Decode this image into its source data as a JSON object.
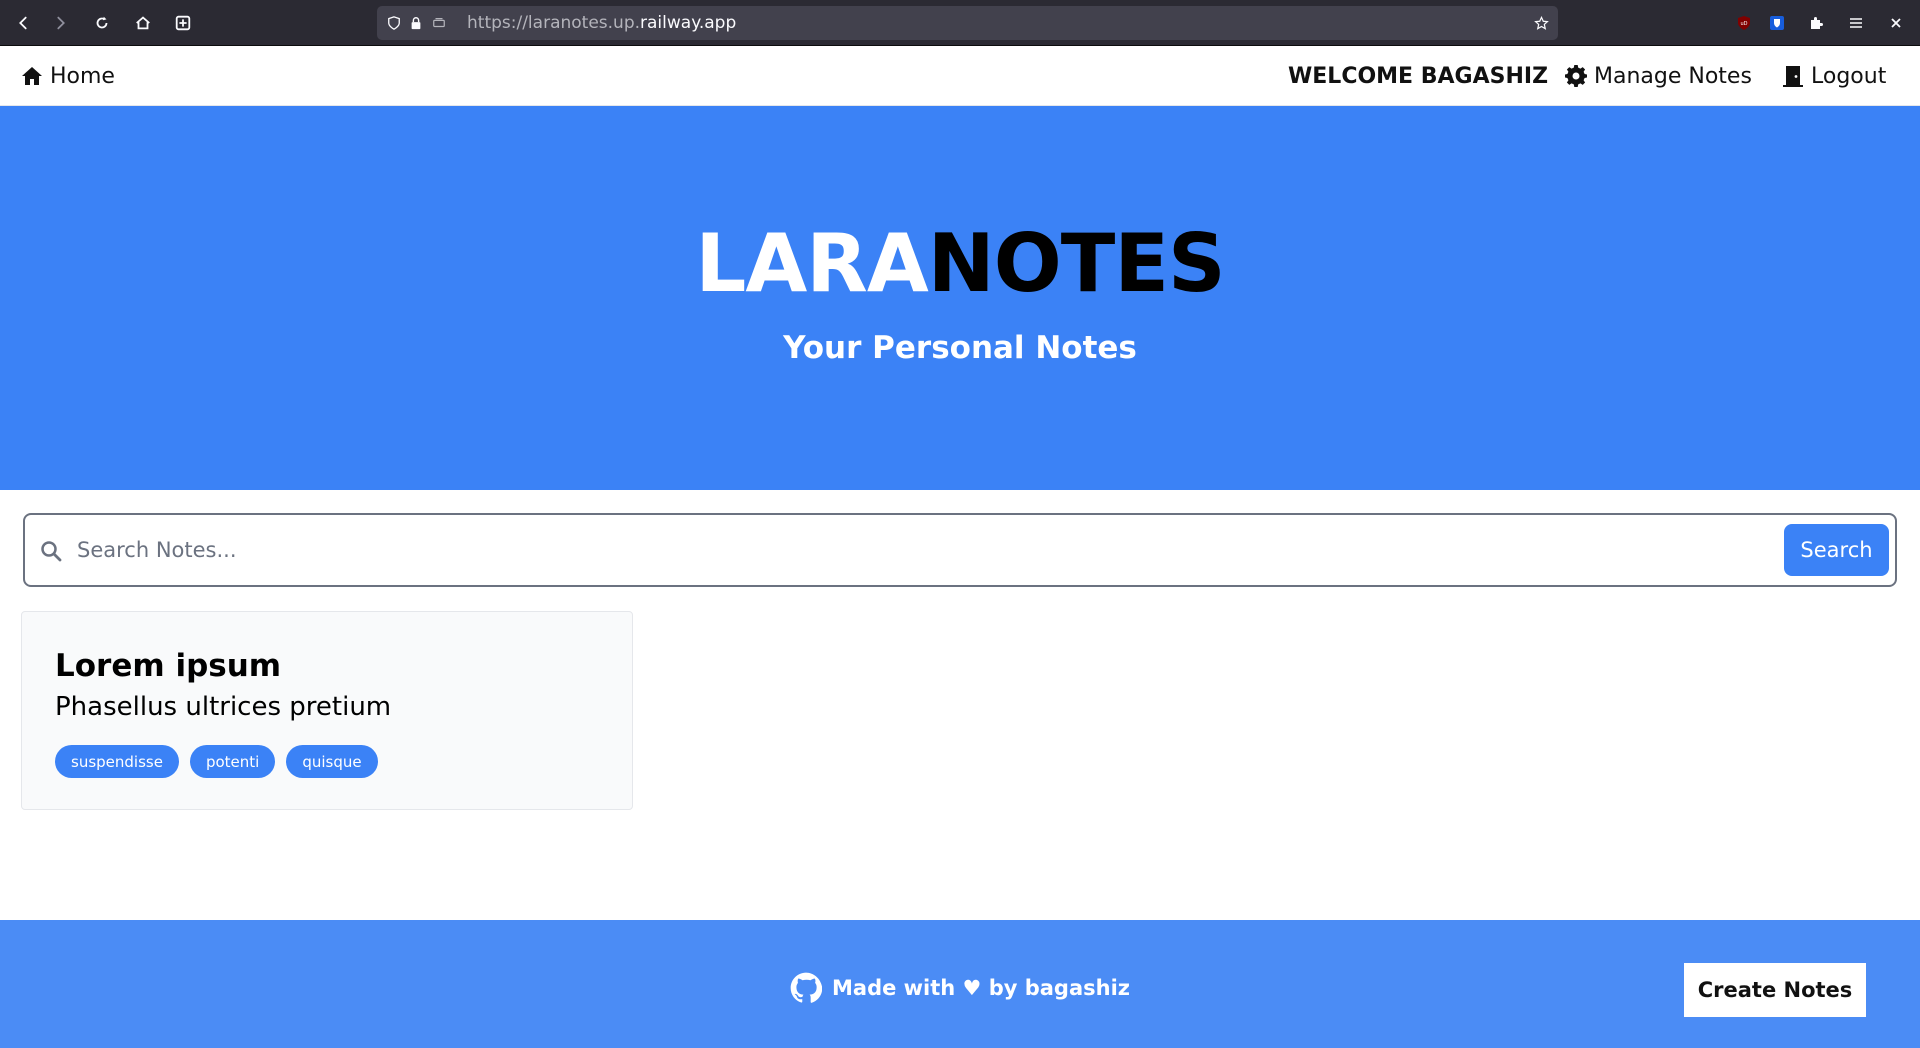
{
  "browser": {
    "url_prefix": "https://laranotes.up.",
    "url_domain": "railway.app",
    "icons": [
      "back-icon",
      "forward-icon",
      "reload-icon",
      "home-icon",
      "new-tab-icon",
      "shield-icon",
      "lock-icon",
      "permissions-icon",
      "bookmark-star-icon",
      "ublock-icon",
      "bitwarden-icon",
      "extensions-icon",
      "menu-icon",
      "close-icon"
    ]
  },
  "nav": {
    "home_label": "Home",
    "welcome": "WELCOME BAGASHIZ",
    "manage_label": "Manage Notes",
    "logout_label": "Logout"
  },
  "hero": {
    "title_white": "LARA",
    "title_black": "NOTES",
    "subtitle": "Your Personal Notes"
  },
  "search": {
    "placeholder": "Search Notes...",
    "value": "",
    "button_label": "Search"
  },
  "notes": [
    {
      "title": "Lorem ipsum",
      "body": "Phasellus ultrices pretium",
      "tags": [
        "suspendisse",
        "potenti",
        "quisque"
      ]
    }
  ],
  "footer": {
    "credit": "Made with ♥ by bagashiz",
    "create_label": "Create Notes"
  },
  "colors": {
    "primary": "#3b82f6",
    "footer": "#4b8cf5",
    "chrome": "#2b2a33"
  }
}
